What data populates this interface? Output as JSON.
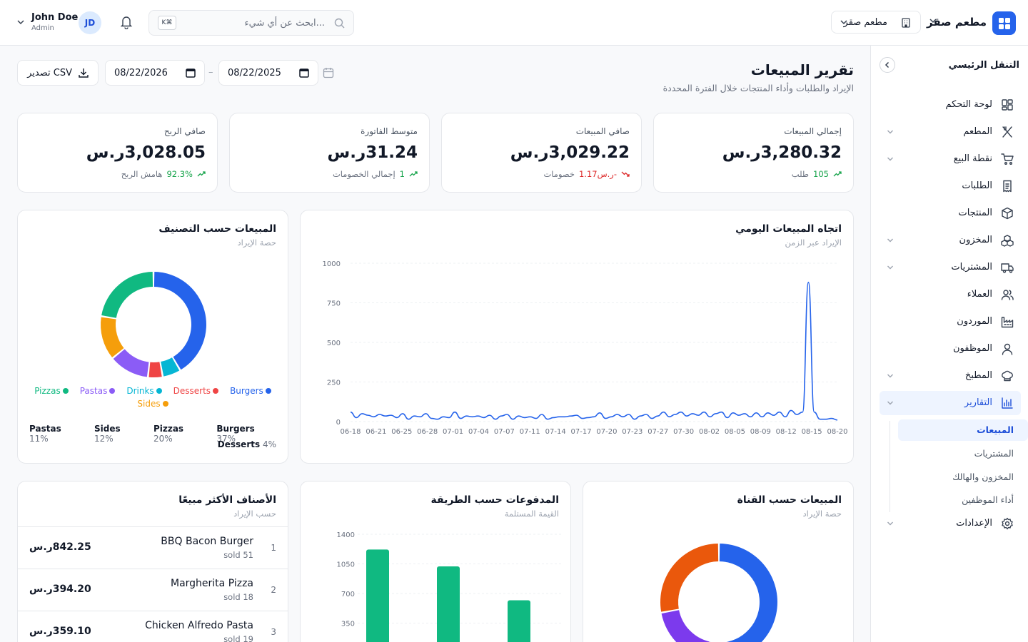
{
  "header": {
    "brand_name": "مطعم صقر",
    "branch": "مطعم صقر",
    "search_placeholder": "ابحث عن أي شيء...",
    "search_shortcut": "K⌘",
    "user_name": "John Doe",
    "user_role": "Admin",
    "user_initials": "JD"
  },
  "sidebar": {
    "title": "التنقل الرئيسي",
    "items": [
      {
        "label": "لوحة التحكم",
        "icon": "dashboard-icon",
        "expandable": false
      },
      {
        "label": "المطعم",
        "icon": "utensils-icon",
        "expandable": true
      },
      {
        "label": "نقطة البيع",
        "icon": "cart-icon",
        "expandable": true
      },
      {
        "label": "الطلبات",
        "icon": "receipt-icon",
        "expandable": false
      },
      {
        "label": "المنتجات",
        "icon": "box-icon",
        "expandable": false
      },
      {
        "label": "المخزون",
        "icon": "boxes-icon",
        "expandable": true
      },
      {
        "label": "المشتريات",
        "icon": "truck-icon",
        "expandable": true
      },
      {
        "label": "العملاء",
        "icon": "users-icon",
        "expandable": false
      },
      {
        "label": "الموردون",
        "icon": "factory-icon",
        "expandable": false
      },
      {
        "label": "الموظفون",
        "icon": "user-icon",
        "expandable": false
      },
      {
        "label": "المطبخ",
        "icon": "chef-hat-icon",
        "expandable": true
      },
      {
        "label": "التقارير",
        "icon": "chart-bars-icon",
        "expandable": true,
        "active": true
      },
      {
        "label": "الإعدادات",
        "icon": "gear-icon",
        "expandable": true
      }
    ],
    "sub_items": [
      {
        "label": "المبيعات",
        "active": true
      },
      {
        "label": "المشتريات"
      },
      {
        "label": "المخزون والهالك"
      },
      {
        "label": "أداء الموظفين"
      }
    ]
  },
  "page": {
    "title": "تقرير المبيعات",
    "subtitle": "الإيراد والطلبات وأداء المنتجات خلال الفترة المحددة",
    "date_from": "08/22/2025",
    "date_to": "08/22/2026",
    "date_separator": "–",
    "export_label": "تصدير CSV"
  },
  "stats": [
    {
      "label": "إجمالي المبيعات",
      "value": "3,280.32ر.س",
      "delta": "105",
      "delta_dir": "up",
      "note": "طلب"
    },
    {
      "label": "صافي المبيعات",
      "value": "3,029.22ر.س",
      "delta": "-ر.س1.17",
      "delta_dir": "down",
      "note": "خصومات"
    },
    {
      "label": "متوسط الفاتورة",
      "value": "31.24ر.س",
      "delta": "1",
      "delta_dir": "up",
      "note": "إجمالي الخصومات"
    },
    {
      "label": "صافي الربح",
      "value": "3,028.05ر.س",
      "delta": "92.3%",
      "delta_dir": "up",
      "note": "هامش الربح"
    }
  ],
  "trend_card": {
    "title": "اتجاه المبيعات اليومي",
    "subtitle": "الإيراد عبر الزمن"
  },
  "category_card": {
    "title": "المبيعات حسب التصنيف",
    "subtitle": "حصة الإيراد",
    "shares": [
      {
        "name": "Burgers",
        "pct": "37%"
      },
      {
        "name": "Pizzas",
        "pct": "20%"
      },
      {
        "name": "Sides",
        "pct": "12%"
      },
      {
        "name": "Pastas",
        "pct": "11%"
      },
      {
        "name": "Desserts",
        "pct": "4%"
      }
    ]
  },
  "top_items_card": {
    "title": "الأصناف الأكثر مبيعًا",
    "subtitle": "حسب الإيراد",
    "items": [
      {
        "rank": "1",
        "name": "BBQ Bacon Burger",
        "sold": "sold 51",
        "revenue": "842.25ر.س"
      },
      {
        "rank": "2",
        "name": "Margherita Pizza",
        "sold": "sold 18",
        "revenue": "394.20ر.س"
      },
      {
        "rank": "3",
        "name": "Chicken Alfredo Pasta",
        "sold": "sold 19",
        "revenue": "359.10ر.س"
      }
    ]
  },
  "payments_card": {
    "title": "المدفوعات حسب الطريقة",
    "subtitle": "القيمة المستلمة"
  },
  "channel_card": {
    "title": "المبيعات حسب القناة",
    "subtitle": "حصة الإيراد"
  },
  "colors": {
    "accent": "#2563eb",
    "positive": "#16a34a",
    "negative": "#dc2626"
  },
  "chart_data": [
    {
      "type": "line",
      "title": "اتجاه المبيعات اليومي",
      "ylim": [
        0,
        1000
      ],
      "yticks": [
        0,
        250,
        500,
        750,
        1000
      ],
      "xticks": [
        "06-18",
        "06-21",
        "06-25",
        "06-28",
        "07-01",
        "07-04",
        "07-07",
        "07-11",
        "07-14",
        "07-17",
        "07-20",
        "07-23",
        "07-27",
        "07-30",
        "08-02",
        "08-05",
        "08-09",
        "08-12",
        "08-15",
        "08-20"
      ],
      "values": [
        60,
        25,
        50,
        40,
        30,
        45,
        35,
        40,
        25,
        50,
        15,
        35,
        30,
        50,
        20,
        15,
        30,
        25,
        60,
        20,
        35,
        30,
        35,
        25,
        40,
        15,
        35,
        45,
        15,
        35,
        25,
        30,
        20,
        45,
        15,
        25,
        30,
        30,
        35,
        40,
        20,
        25,
        30,
        55,
        20,
        30,
        45,
        30,
        45,
        15,
        35,
        45,
        20,
        35,
        60,
        30,
        45,
        60,
        35,
        50,
        40,
        60,
        30,
        50,
        60,
        25,
        55,
        40,
        50,
        30,
        55,
        30,
        55,
        40,
        60,
        30,
        70,
        45,
        60,
        880,
        60,
        15,
        15,
        20,
        10
      ],
      "grid": true
    },
    {
      "type": "pie",
      "title": "المبيعات حسب التصنيف",
      "categories": [
        "Burgers",
        "Drinks",
        "Desserts",
        "Pastas",
        "Sides",
        "Pizzas"
      ],
      "values": [
        37,
        5,
        4,
        11,
        12,
        20
      ],
      "colors": [
        "#2563eb",
        "#06b6d4",
        "#ef4444",
        "#8b5cf6",
        "#f59e0b",
        "#10b981"
      ]
    },
    {
      "type": "bar",
      "title": "المدفوعات حسب الطريقة",
      "ylim": [
        0,
        1400
      ],
      "yticks": [
        350,
        700,
        1050,
        1400
      ],
      "values": [
        1220,
        1020,
        620
      ],
      "colors": [
        "#10b981"
      ]
    },
    {
      "type": "pie",
      "title": "المبيعات حسب القناة",
      "values": [
        46,
        16,
        24
      ],
      "colors": [
        "#2563eb",
        "#7c3aed",
        "#ea580c"
      ]
    }
  ]
}
